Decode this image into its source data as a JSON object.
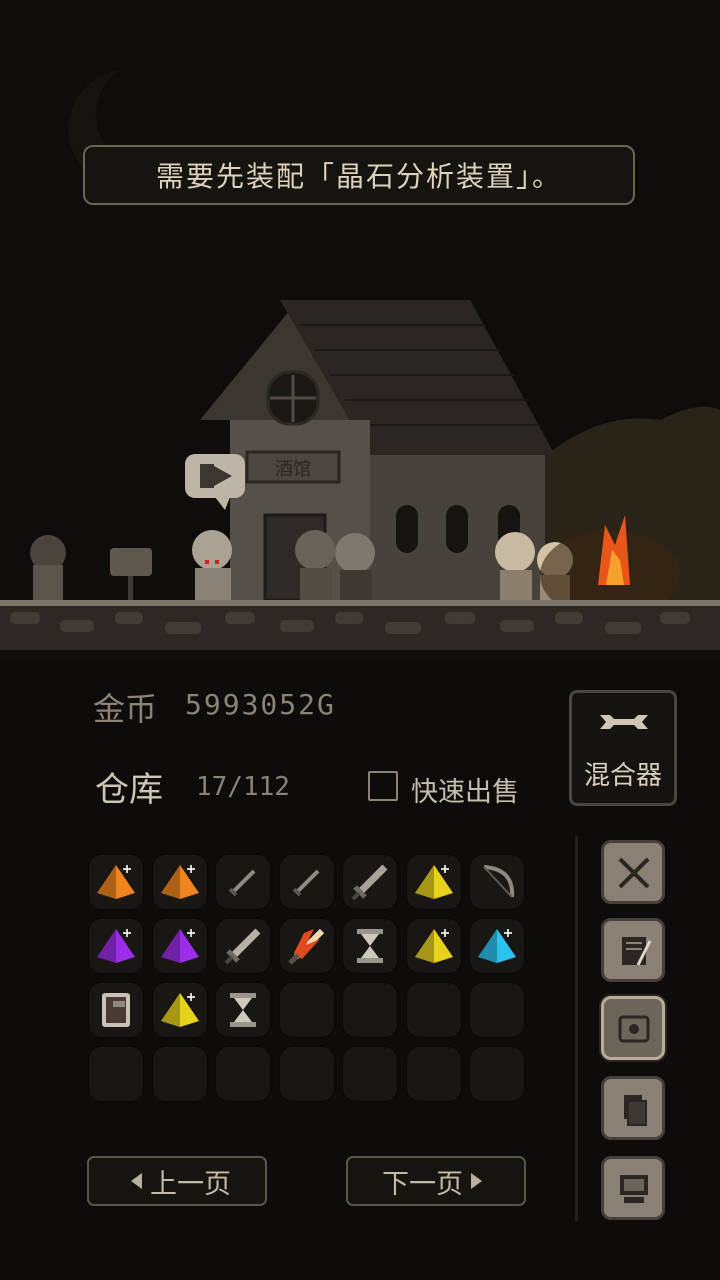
{
  "message": "需要先装配「晶石分析装置」。",
  "tavern_sign": "酒馆",
  "gold": {
    "label": "金币",
    "value": "5993052G"
  },
  "mixer": {
    "label": "混合器",
    "icon": "wrench-icon"
  },
  "warehouse": {
    "label": "仓库",
    "count": "17/112"
  },
  "quick_sell": {
    "label": "快速出售",
    "checked": false
  },
  "inventory": [
    {
      "icon": "pyramid-crystal",
      "color": "#f0841e"
    },
    {
      "icon": "pyramid-crystal",
      "color": "#f0841e"
    },
    {
      "icon": "dagger",
      "color": "#8e8a82"
    },
    {
      "icon": "dagger",
      "color": "#8e8a82"
    },
    {
      "icon": "sword",
      "color": "#a8a39b"
    },
    {
      "icon": "pyramid-crystal",
      "color": "#e6d21c"
    },
    {
      "icon": "bow",
      "color": "#8e8a82"
    },
    {
      "icon": "pyramid-crystal",
      "color": "#9b2ee6"
    },
    {
      "icon": "pyramid-crystal",
      "color": "#9b2ee6"
    },
    {
      "icon": "sword",
      "color": "#b5b0a8"
    },
    {
      "icon": "flame-sword",
      "color": "#e14a1e"
    },
    {
      "icon": "hourglass",
      "color": "#9a948a"
    },
    {
      "icon": "pyramid-crystal",
      "color": "#e6d21c"
    },
    {
      "icon": "pyramid-crystal",
      "color": "#2ec3ee"
    },
    {
      "icon": "armor",
      "color": "#8e8a82"
    },
    {
      "icon": "pyramid-crystal",
      "color": "#e6d21c"
    },
    {
      "icon": "hourglass",
      "color": "#9a948a"
    }
  ],
  "total_slots": 28,
  "side_buttons": [
    {
      "icon": "crossed-swords-icon"
    },
    {
      "icon": "scroll-icon"
    },
    {
      "icon": "map-icon"
    },
    {
      "icon": "documents-icon"
    },
    {
      "icon": "computer-icon"
    }
  ],
  "pagination": {
    "prev": "上一页",
    "next": "下一页"
  }
}
